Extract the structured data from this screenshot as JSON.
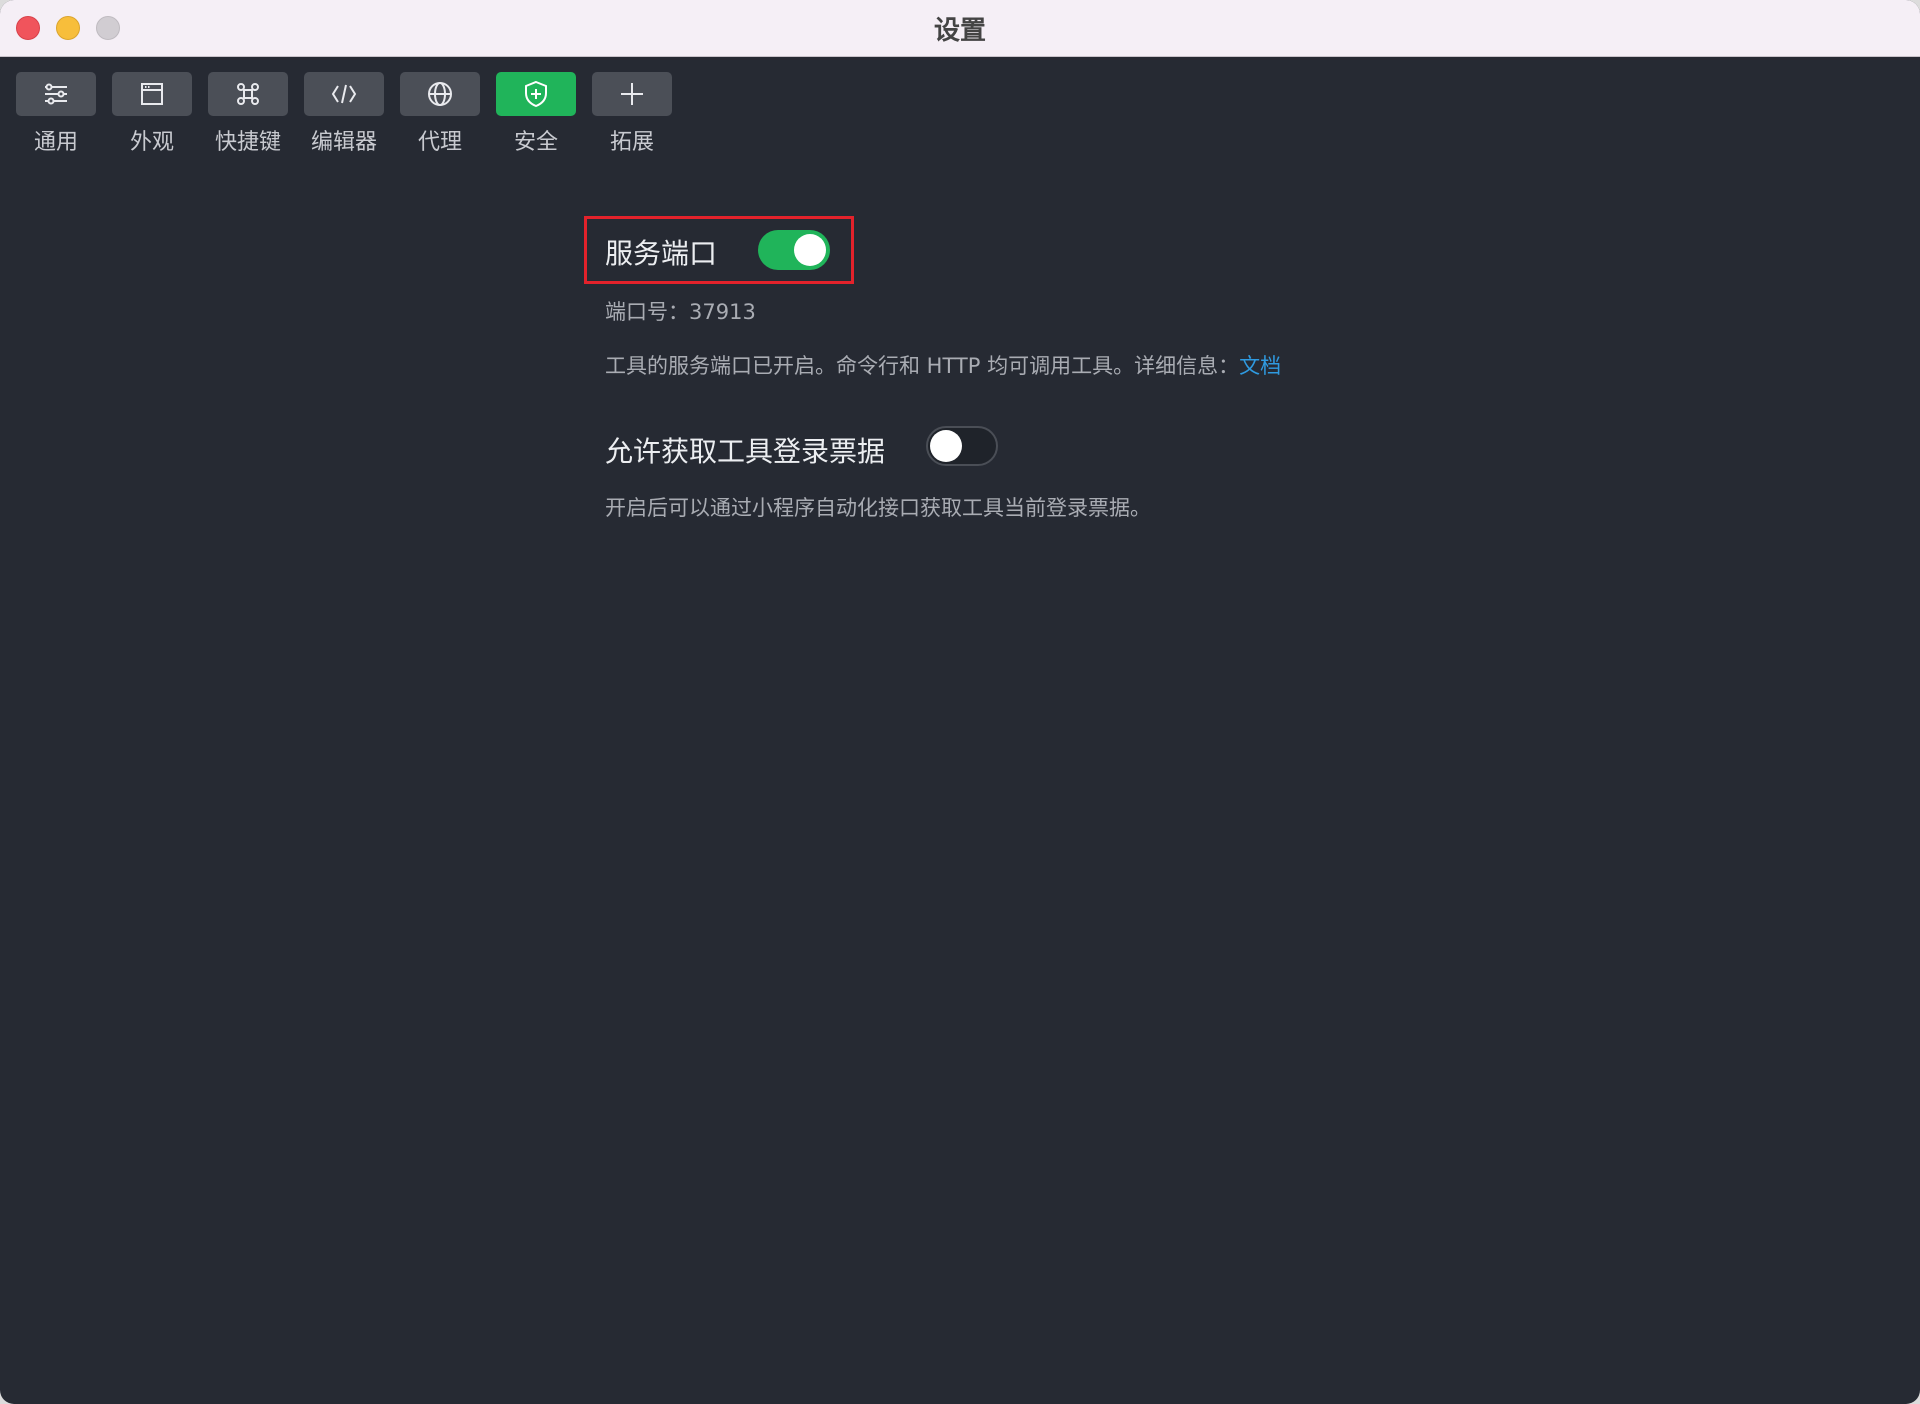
{
  "window": {
    "title": "设置"
  },
  "toolbar": {
    "items": [
      {
        "label": "通用",
        "icon": "sliders-icon"
      },
      {
        "label": "外观",
        "icon": "window-icon"
      },
      {
        "label": "快捷键",
        "icon": "command-icon"
      },
      {
        "label": "编辑器",
        "icon": "code-icon"
      },
      {
        "label": "代理",
        "icon": "globe-icon"
      },
      {
        "label": "安全",
        "icon": "shield-plus-icon",
        "active": true
      },
      {
        "label": "拓展",
        "icon": "plus-icon"
      }
    ]
  },
  "security": {
    "service_port": {
      "title": "服务端口",
      "enabled": true,
      "port_line": "端口号：37913",
      "description": "工具的服务端口已开启。命令行和 HTTP 均可调用工具。详细信息：",
      "doc_link": "文档"
    },
    "login_ticket": {
      "title": "允许获取工具登录票据",
      "enabled": false,
      "description": "开启后可以通过小程序自动化接口获取工具当前登录票据。"
    }
  },
  "colors": {
    "background": "#262a33",
    "accent_green": "#20b45a",
    "link_blue": "#2f9ae0",
    "highlight_red": "#e3222b"
  }
}
